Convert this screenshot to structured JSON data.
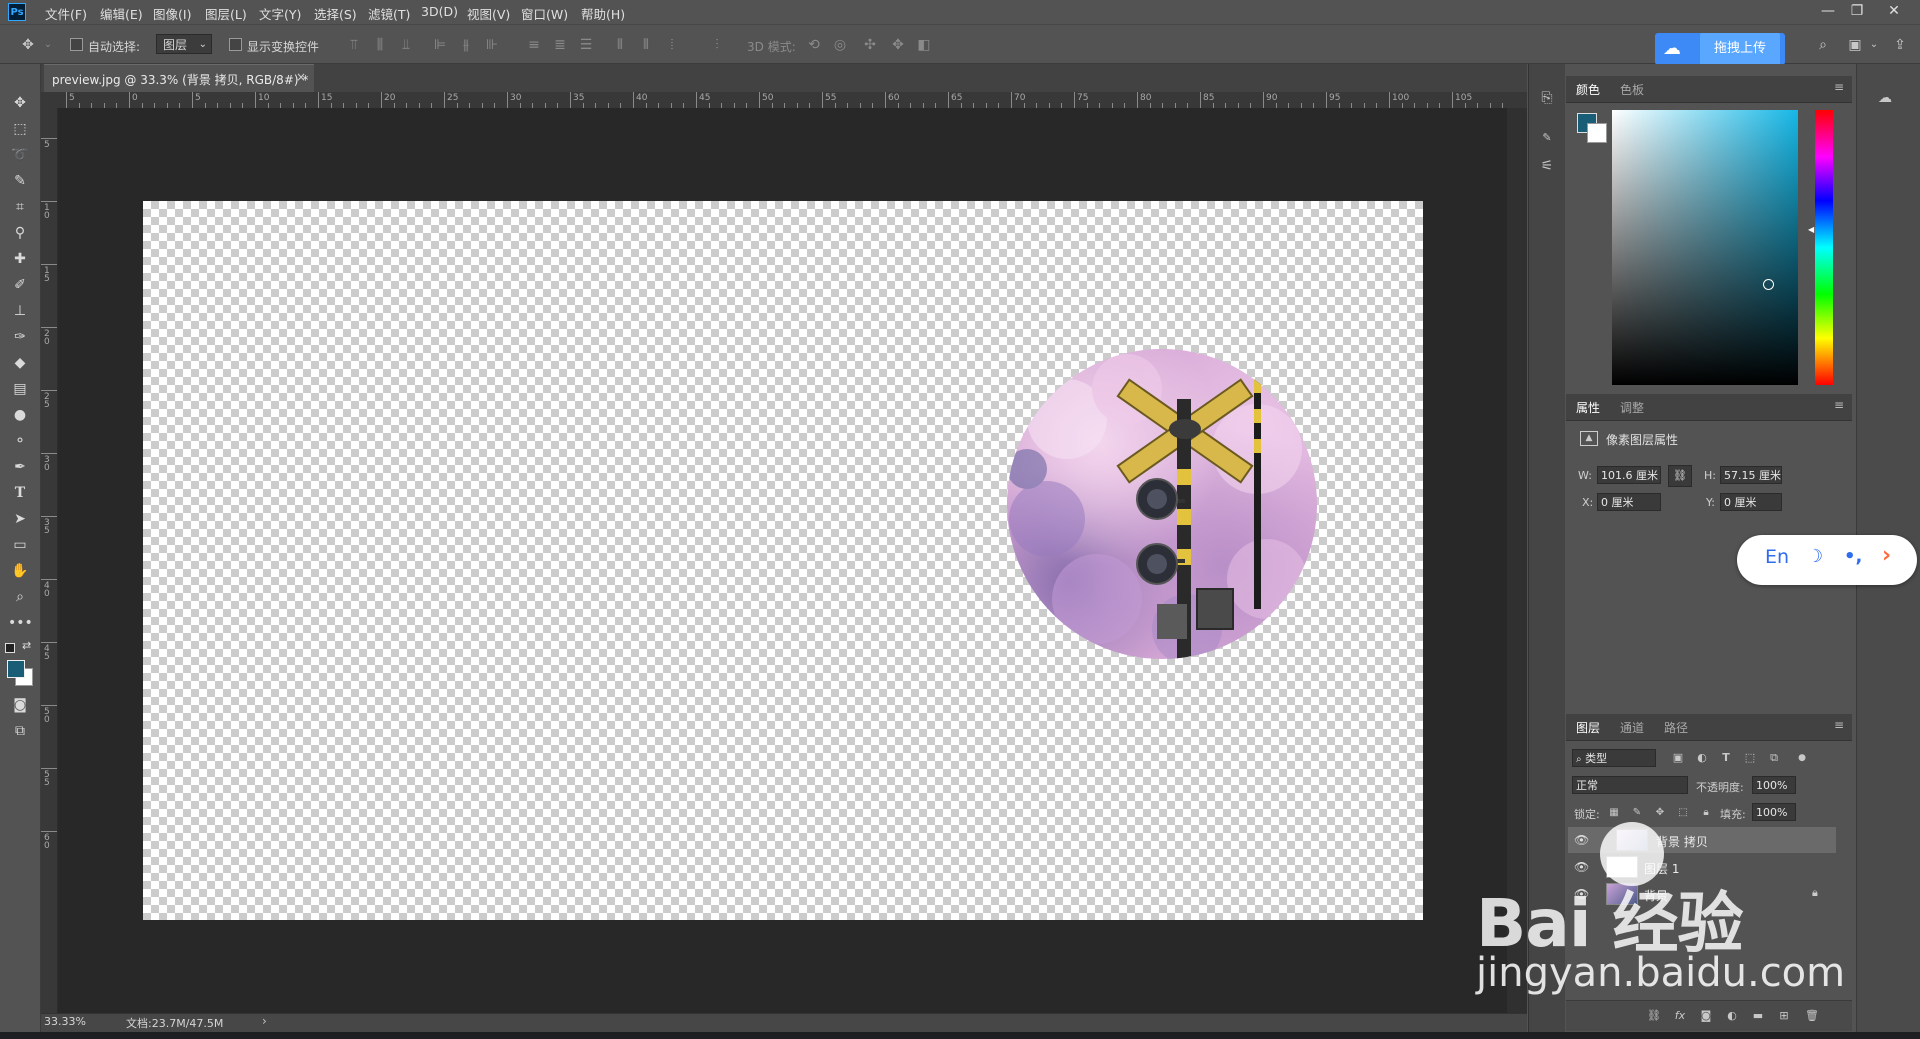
{
  "app": {
    "logo": "Ps",
    "menus": [
      "文件(F)",
      "编辑(E)",
      "图像(I)",
      "图层(L)",
      "文字(Y)",
      "选择(S)",
      "滤镜(T)",
      "3D(D)",
      "视图(V)",
      "窗口(W)",
      "帮助(H)"
    ],
    "window_controls": [
      "—",
      "❐",
      "✕"
    ]
  },
  "options_bar": {
    "auto_select_label": "自动选择:",
    "auto_select_checked": false,
    "auto_select_target": "图层",
    "show_transform_label": "显示变换控件",
    "show_transform_checked": false,
    "mode_3d_label": "3D 模式:",
    "upload_label": "拖拽上传"
  },
  "document": {
    "tab_title": "preview.jpg @ 33.3% (背景 拷贝, RGB/8#) *",
    "close_glyph": "×",
    "zoom": "33.33%",
    "doc_size": "文档:23.7M/47.5M",
    "status_arrow": "›"
  },
  "rulers": {
    "horizontal": [
      "5",
      "0",
      "5",
      "10",
      "15",
      "20",
      "25",
      "30",
      "35",
      "40",
      "45",
      "50",
      "55",
      "60",
      "65",
      "70",
      "75",
      "80",
      "85",
      "90",
      "95",
      "100",
      "105"
    ],
    "vertical": [
      "5",
      "1 0",
      "1 5",
      "2 0",
      "2 5",
      "3 0",
      "3 5",
      "4 0",
      "4 5",
      "5 0",
      "5 5",
      "6 0"
    ]
  },
  "color_panel": {
    "tabs": [
      "颜色",
      "色板"
    ],
    "active_tab": 0,
    "foreground": "#1a5d76",
    "background": "#ffffff",
    "menu_glyph": "≡"
  },
  "properties_panel": {
    "tabs": [
      "属性",
      "调整"
    ],
    "active_tab": 0,
    "title": "像素图层属性",
    "w_label": "W:",
    "w_value": "101.6 厘米",
    "h_label": "H:",
    "h_value": "57.15 厘米",
    "x_label": "X:",
    "x_value": "0 厘米",
    "y_label": "Y:",
    "y_value": "0 厘米",
    "menu_glyph": "≡"
  },
  "layers_panel": {
    "tabs": [
      "图层",
      "通道",
      "路径"
    ],
    "active_tab": 0,
    "filter_label": "类型",
    "blend_mode": "正常",
    "opacity_label": "不透明度:",
    "opacity_value": "100%",
    "lock_label": "锁定:",
    "fill_label": "填充:",
    "fill_value": "100%",
    "menu_glyph": "≡",
    "layers": [
      {
        "name": "背景 拷贝",
        "visible": true,
        "selected": true
      },
      {
        "name": "图层 1",
        "visible": true,
        "selected": false
      },
      {
        "name": "背景",
        "visible": true,
        "selected": false,
        "locked": true
      }
    ],
    "bottom_icons": [
      "link-icon",
      "fx-icon",
      "mask-icon",
      "adjustment-icon",
      "group-icon",
      "new-layer-icon",
      "trash-icon"
    ]
  },
  "language_widget": {
    "lang": "En",
    "moon": "☽",
    "punct": "•,",
    "arrow": "›"
  },
  "watermark": {
    "brand": "Bai 经验",
    "url": "jingyan.baidu.com"
  }
}
